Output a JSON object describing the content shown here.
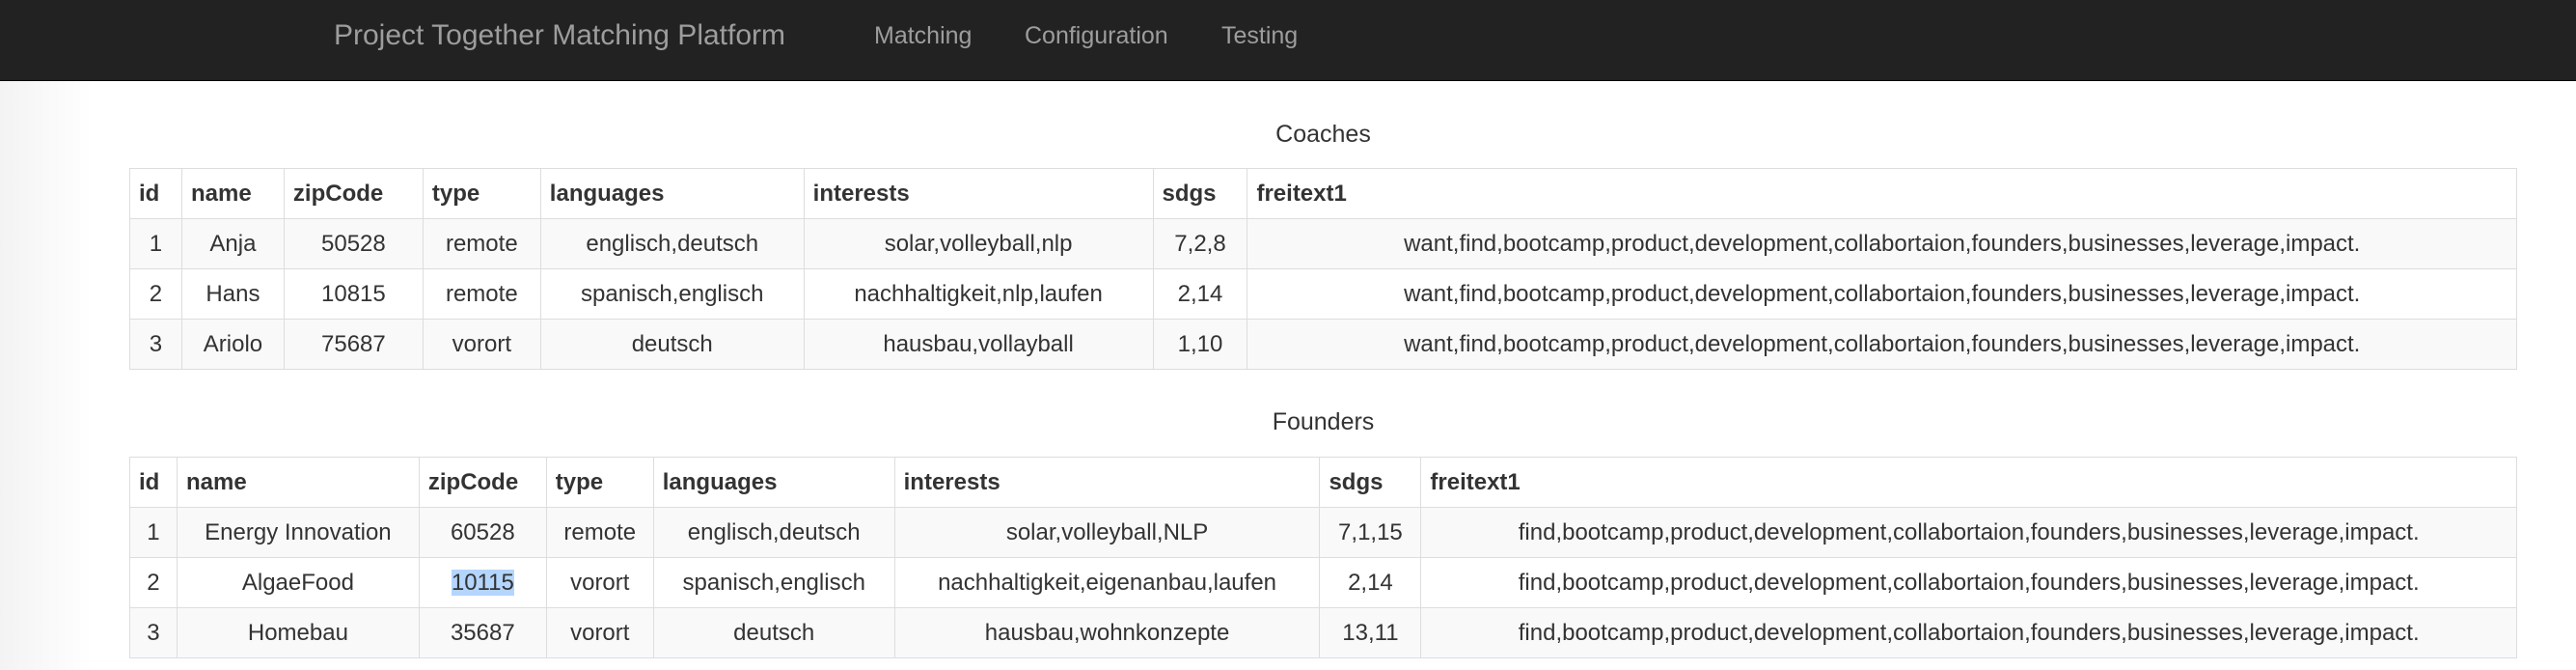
{
  "navbar": {
    "brand": "Project Together Matching Platform",
    "links": [
      "Matching",
      "Configuration",
      "Testing"
    ]
  },
  "coaches": {
    "title": "Coaches",
    "columns": [
      "id",
      "name",
      "zipCode",
      "type",
      "languages",
      "interests",
      "sdgs",
      "freitext1"
    ],
    "rows": [
      [
        "1",
        "Anja",
        "50528",
        "remote",
        "englisch,deutsch",
        "solar,volleyball,nlp",
        "7,2,8",
        "want,find,bootcamp,product,development,collabortaion,founders,businesses,leverage,impact."
      ],
      [
        "2",
        "Hans",
        "10815",
        "remote",
        "spanisch,englisch",
        "nachhaltigkeit,nlp,laufen",
        "2,14",
        "want,find,bootcamp,product,development,collabortaion,founders,businesses,leverage,impact."
      ],
      [
        "3",
        "Ariolo",
        "75687",
        "vorort",
        "deutsch",
        "hausbau,vollayball",
        "1,10",
        "want,find,bootcamp,product,development,collabortaion,founders,businesses,leverage,impact."
      ]
    ]
  },
  "founders": {
    "title": "Founders",
    "columns": [
      "id",
      "name",
      "zipCode",
      "type",
      "languages",
      "interests",
      "sdgs",
      "freitext1"
    ],
    "rows": [
      [
        "1",
        "Energy Innovation",
        "60528",
        "remote",
        "englisch,deutsch",
        "solar,volleyball,NLP",
        "7,1,15",
        "find,bootcamp,product,development,collabortaion,founders,businesses,leverage,impact."
      ],
      [
        "2",
        "AlgaeFood",
        "10115",
        "vorort",
        "spanisch,englisch",
        "nachhaltigkeit,eigenanbau,laufen",
        "2,14",
        "find,bootcamp,product,development,collabortaion,founders,businesses,leverage,impact."
      ],
      [
        "3",
        "Homebau",
        "35687",
        "vorort",
        "deutsch",
        "hausbau,wohnkonzepte",
        "13,11",
        "find,bootcamp,product,development,collabortaion,founders,businesses,leverage,impact."
      ]
    ]
  },
  "selection": {
    "table": "founders",
    "row": 2,
    "column": "zipCode",
    "text": "10115"
  },
  "colors": {
    "navbar_bg": "#222222",
    "nav_text": "#9d9d9d",
    "table_border": "#dddddd",
    "row_stripe": "#f9f9f9",
    "selection_highlight": "#b4d5fe"
  }
}
